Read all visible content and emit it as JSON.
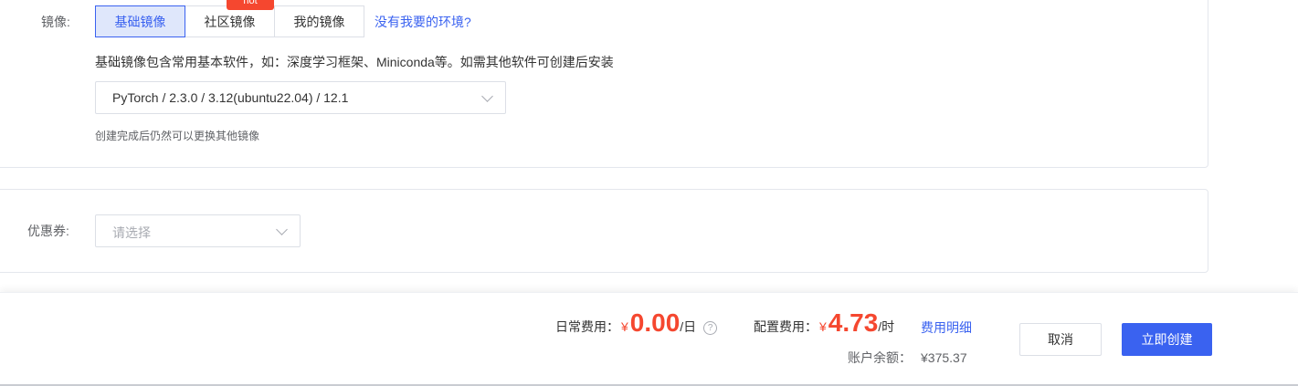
{
  "image_section": {
    "label": "镜像:",
    "tabs": [
      {
        "label": "基础镜像",
        "active": true
      },
      {
        "label": "社区镜像",
        "active": false,
        "badge": "hot"
      },
      {
        "label": "我的镜像",
        "active": false
      }
    ],
    "no_env_link": "没有我要的环境?",
    "description": "基础镜像包含常用基本软件，如：深度学习框架、Miniconda等。如需其他软件可创建后安装",
    "selected_image": "PyTorch / 2.3.0 / 3.12(ubuntu22.04) / 12.1",
    "hint": "创建完成后仍然可以更换其他镜像"
  },
  "coupon_section": {
    "label": "优惠券:",
    "placeholder": "请选择"
  },
  "footer": {
    "daily_fee_label": "日常费用：",
    "daily_currency": "¥",
    "daily_amount": "0.00",
    "daily_unit": "/日",
    "help_icon": "question-circle-icon",
    "config_fee_label": "配置费用：",
    "config_currency": "¥",
    "config_amount": "4.73",
    "config_unit": "/时",
    "fee_detail_link": "费用明细",
    "balance_label": "账户余额：",
    "balance_value": "¥375.37",
    "cancel_label": "取消",
    "create_label": "立即创建"
  },
  "colors": {
    "primary": "#3a62f0",
    "price_red": "#f5472f",
    "hot_badge": "#f5472f"
  }
}
